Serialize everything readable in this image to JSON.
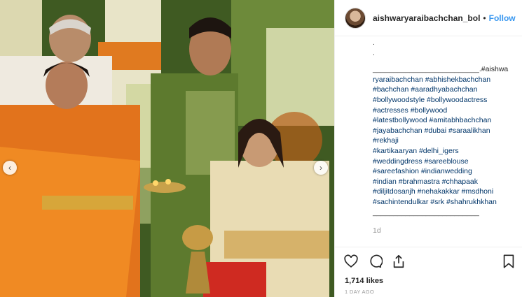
{
  "post": {
    "photo_alt": "",
    "nav_prev": "‹",
    "nav_next": "›"
  },
  "header": {
    "username": "aishwaryaraibachchan_bol",
    "separator": "•",
    "follow_label": "Follow"
  },
  "caption": {
    "lines": [
      ".",
      ".",
      "__________________________.#aishwa",
      "ryaraibachchan #abhishekbachchan",
      "#bachchan #aaradhyabachchan",
      "#bollywoodstyle #bollywoodactress",
      "#actresses #bollywood",
      "#latestbollywood #amitabhbachchan",
      "#jayabachchan #dubai #saraalikhan",
      "#rekhaji",
      "#kartikaaryan #delhi_igers",
      "#weddingdress #sareeblouse",
      "#sareefashion #indianwedding",
      "#indian #brahmastra #chhapaak",
      "#diljitdosanjh #nehakakkar #msdhoni",
      "#sachintendulkar #srk #shahrukhkhan",
      "__________________________"
    ],
    "time_ago": "1d"
  },
  "actions": {
    "like_icon": "heart-icon",
    "comment_icon": "comment-icon",
    "share_icon": "share-icon",
    "save_icon": "bookmark-icon"
  },
  "likes": "1,714 likes",
  "date": "1 DAY AGO"
}
